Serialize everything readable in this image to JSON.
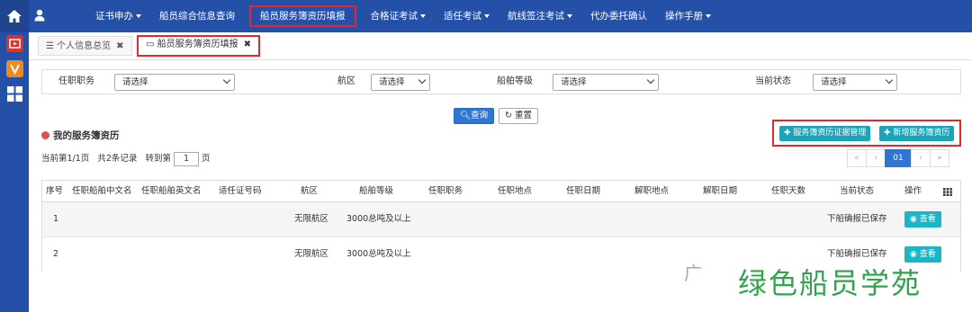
{
  "nav": {
    "items": [
      {
        "label": "证书申办",
        "dropdown": true
      },
      {
        "label": "船员综合信息查询",
        "dropdown": false
      },
      {
        "label": "船员服务簿资历填报",
        "dropdown": false,
        "active": true
      },
      {
        "label": "合格证考试",
        "dropdown": true
      },
      {
        "label": "适任考试",
        "dropdown": true
      },
      {
        "label": "航线签注考试",
        "dropdown": true
      },
      {
        "label": "代办委托确认",
        "dropdown": false
      },
      {
        "label": "操作手册",
        "dropdown": true
      }
    ]
  },
  "tabs": [
    {
      "label": "个人信息总览",
      "close": "✖"
    },
    {
      "label": "船员服务簿资历填报",
      "close": "✖"
    }
  ],
  "filters": {
    "position_label": "任职职务",
    "position_value": "请选择",
    "area_label": "航区",
    "area_value": "请选择",
    "grade_label": "船舶等级",
    "grade_value": "请选择",
    "status_label": "当前状态",
    "status_value": "请选择"
  },
  "buttons": {
    "query": "查询",
    "reset": "重置",
    "cert_manage": "服务簿资历证据管理",
    "add_record": "新增服务簿资历"
  },
  "section_title": "我的服务簿资历",
  "paging": {
    "current_text": "当前第1/1页",
    "total_text": "共2条记录",
    "goto_text": "转到第",
    "goto_value": "1",
    "page_suffix": "页",
    "current_page": "01"
  },
  "table": {
    "headers": [
      "序号",
      "任职船舶中文名",
      "任职船舶英文名",
      "适任证号码",
      "航区",
      "船舶等级",
      "任职职务",
      "任职地点",
      "任职日期",
      "解职地点",
      "解职日期",
      "任职天数",
      "当前状态",
      "操作"
    ],
    "rows": [
      {
        "index": "1",
        "area": "无限航区",
        "grade": "3000总吨及以上",
        "status": "下船确报已保存",
        "action": "查看"
      },
      {
        "index": "2",
        "area": "无限航区",
        "grade": "3000总吨及以上",
        "status": "下船确报已保存",
        "action": "查看"
      }
    ]
  },
  "watermark": {
    "text": "绿色船员学苑",
    "grey": "广"
  },
  "colors": {
    "nav_bg": "#2450a8",
    "highlight": "#e0282e",
    "teal": "#1ba3b8",
    "primary": "#2f76d2"
  }
}
